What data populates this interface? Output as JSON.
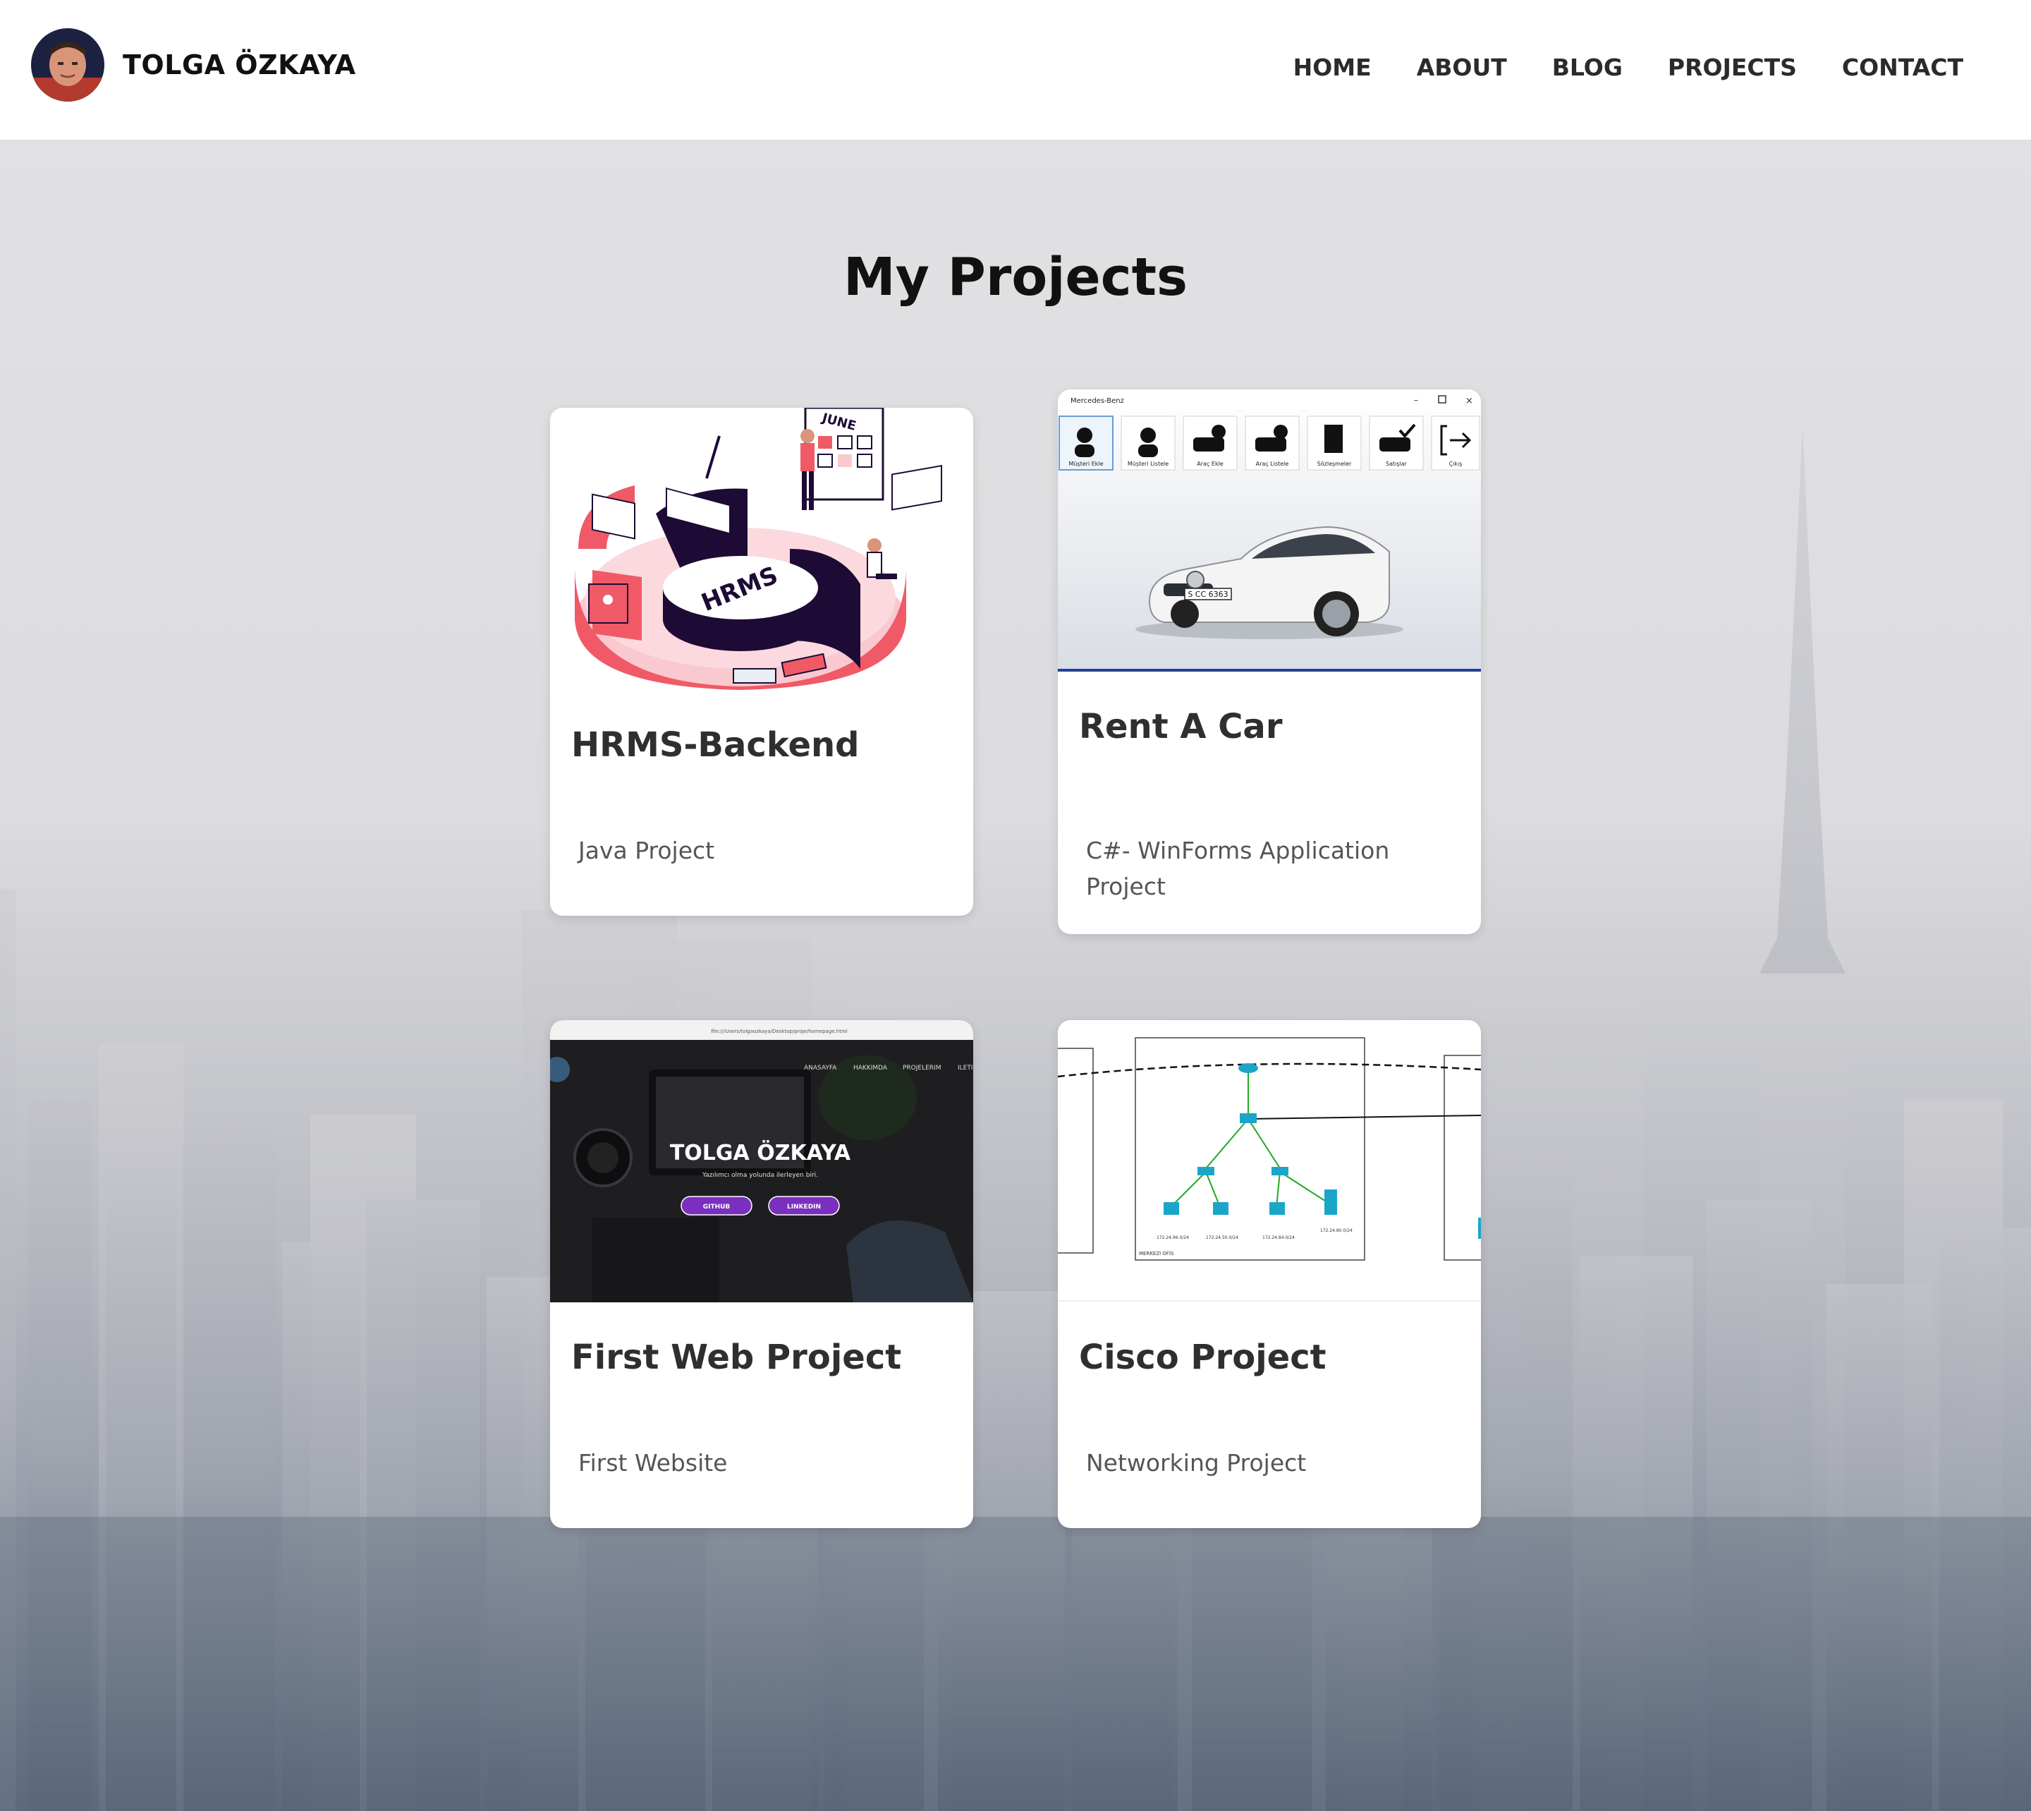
{
  "header": {
    "brand_name": "TOLGA ÖZKAYA",
    "nav": [
      "HOME",
      "ABOUT",
      "BLOG",
      "PROJECTS",
      "CONTACT"
    ]
  },
  "page": {
    "title": "My Projects"
  },
  "projects": [
    {
      "title": "HRMS-Backend",
      "description": "Java Project",
      "image_text": [
        "HRMS",
        "JUNE"
      ]
    },
    {
      "title": "Rent A Car",
      "description": "C#- WinForms Application Project",
      "image_text": {
        "window_title": "Mercedes-Benz",
        "toolbar": [
          "Müşteri Ekle",
          "Müşteri Listele",
          "Araç Ekle",
          "Araç Listele",
          "Sözleşmeler",
          "Satışlar",
          "Çıkış"
        ],
        "plate": "S CC 6363"
      }
    },
    {
      "title": "First Web Project",
      "description": "First Website",
      "image_text": {
        "url": "file:///Users/tolgaozkaya/Desktop/proje/homepage.html",
        "menu": [
          "ANASAYFA",
          "HAKKIMDA",
          "PROJELERIM",
          "ILETI"
        ],
        "hero_name": "TOLGA ÖZKAYA",
        "hero_subtitle": "Yazılımcı olma yolunda ilerleyen biri.",
        "buttons": [
          "GITHUB",
          "LINKEDIN"
        ]
      }
    },
    {
      "title": "Cisco Project",
      "description": "Networking Project",
      "image_text": {
        "label": "MERKEZİ OFİS"
      }
    }
  ],
  "colors": {
    "header_bg": "#ffffff",
    "card_bg": "#ffffff",
    "hrms_accent": "#f05a67",
    "hrms_dark": "#1d0b35",
    "web_button": "#7b2fbf"
  }
}
